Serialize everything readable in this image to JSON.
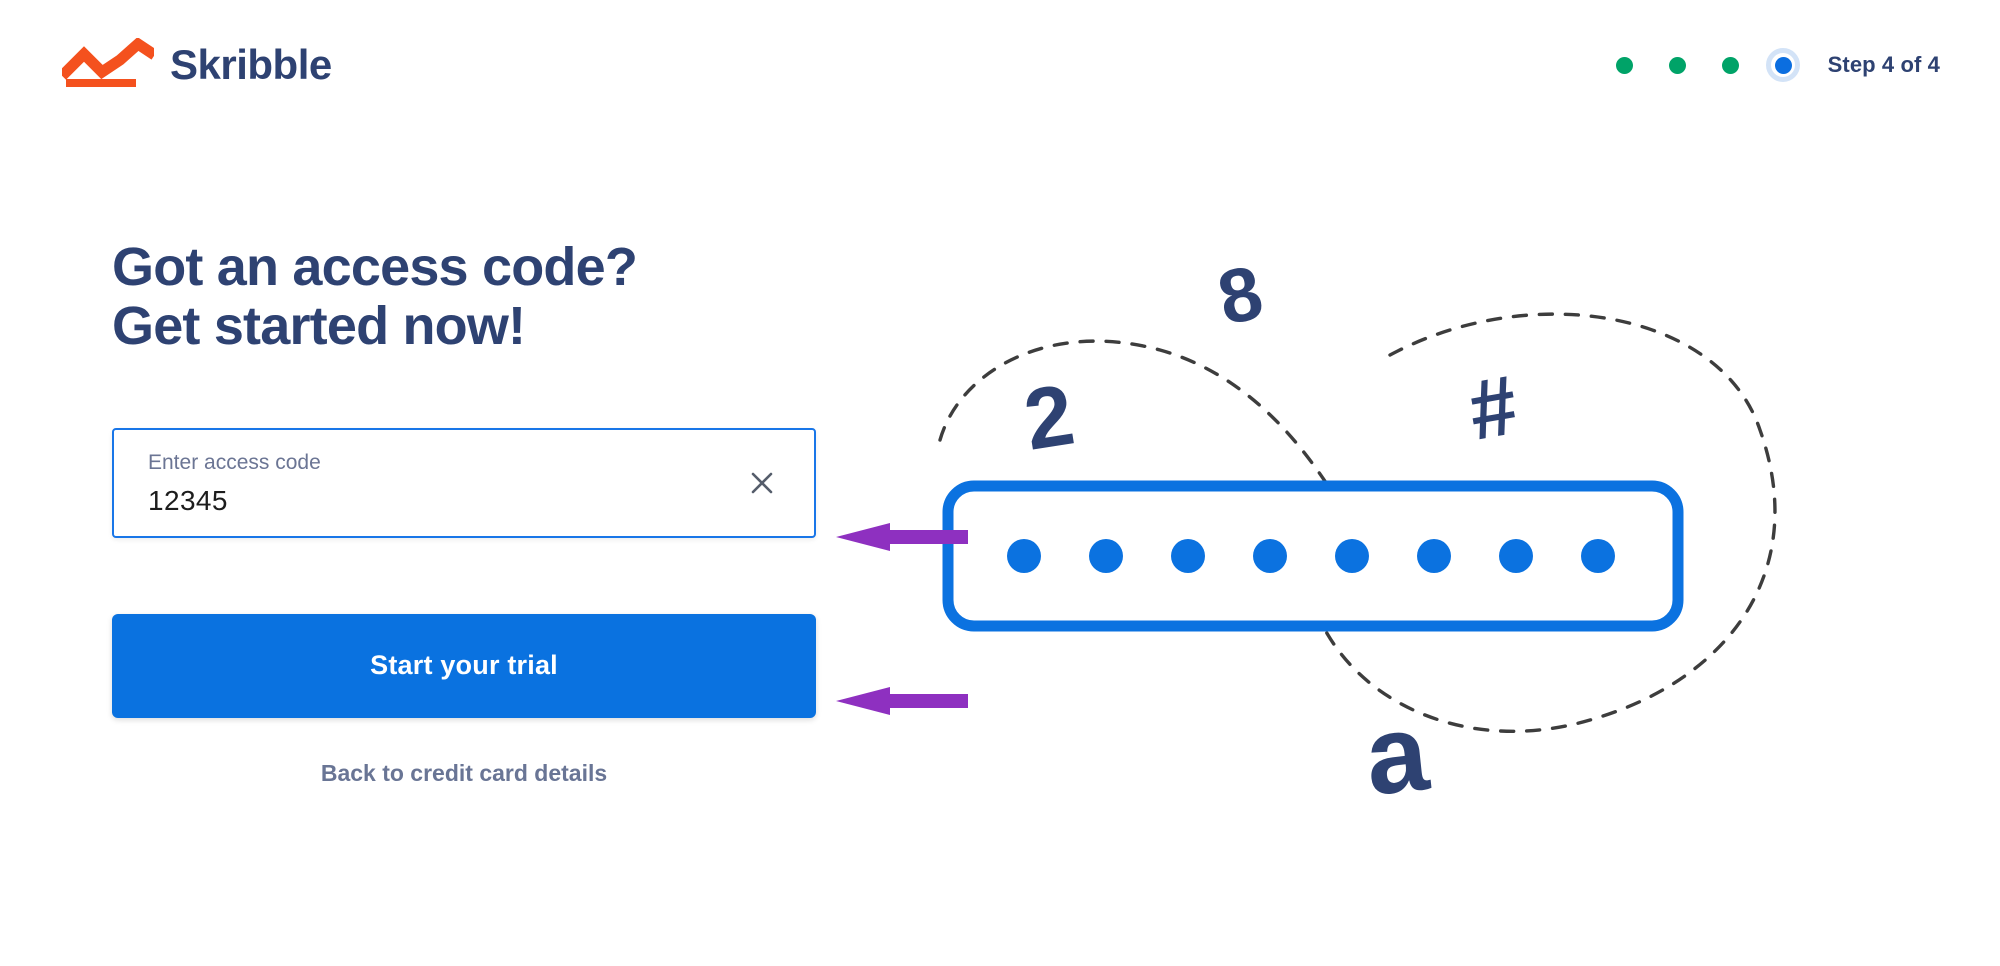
{
  "brand": {
    "name": "Skribble",
    "logo_icon": "skribble-zigzag-logo",
    "logo_color": "#f4511e",
    "name_color": "#2e4272"
  },
  "header": {
    "stepper": {
      "label": "Step 4 of 4",
      "current_step": 4,
      "total_steps": 4,
      "dots": [
        {
          "state": "done",
          "color": "#00a368"
        },
        {
          "state": "done",
          "color": "#00a368"
        },
        {
          "state": "done",
          "color": "#00a368"
        },
        {
          "state": "current",
          "color": "#0b6ee0",
          "ring_color": "#d3e3f7"
        }
      ]
    }
  },
  "main": {
    "headline_line1": "Got an access code?",
    "headline_line2": "Get started now!",
    "access_code_field": {
      "label": "Enter access code",
      "value": "12345",
      "placeholder": "Enter access code",
      "clear_icon": "close-x-icon",
      "border_color": "#1976e8"
    },
    "primary_button": {
      "label": "Start your trial",
      "color": "#0a72e0"
    },
    "back_link": {
      "label": "Back to credit card details",
      "color": "#697595"
    }
  },
  "illustration": {
    "name": "access-code-input-illustration",
    "password_dots_count": 8,
    "dot_color": "#0b72e0",
    "box_border_color": "#0b72e0",
    "floating_characters": [
      "8",
      "2",
      "#",
      "a"
    ],
    "character_color": "#2e4272",
    "dashed_path_color": "#3a3a3a"
  },
  "annotations": {
    "arrow_color": "#8e30c0",
    "arrows": [
      {
        "name": "arrow-to-access-code-field",
        "target": "access_code_field"
      },
      {
        "name": "arrow-to-start-trial-button",
        "target": "primary_button"
      }
    ]
  }
}
